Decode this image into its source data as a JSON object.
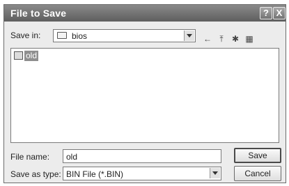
{
  "window": {
    "title": "File to Save"
  },
  "titlebar_buttons": {
    "help": "?",
    "close": "X"
  },
  "location": {
    "label": "Save in:",
    "value": "bios"
  },
  "toolbar": [
    {
      "name": "back-icon",
      "glyph": "←"
    },
    {
      "name": "up-folder-icon",
      "glyph": "⤒"
    },
    {
      "name": "new-folder-icon",
      "glyph": "✱"
    },
    {
      "name": "view-menu-icon",
      "glyph": "▦"
    }
  ],
  "files": [
    {
      "name": "old",
      "selected": true
    }
  ],
  "filename": {
    "label": "File name:",
    "value": "old"
  },
  "filetype": {
    "label": "Save as type:",
    "value": "BIN File (*.BIN)"
  },
  "buttons": {
    "save": "Save",
    "cancel": "Cancel"
  }
}
